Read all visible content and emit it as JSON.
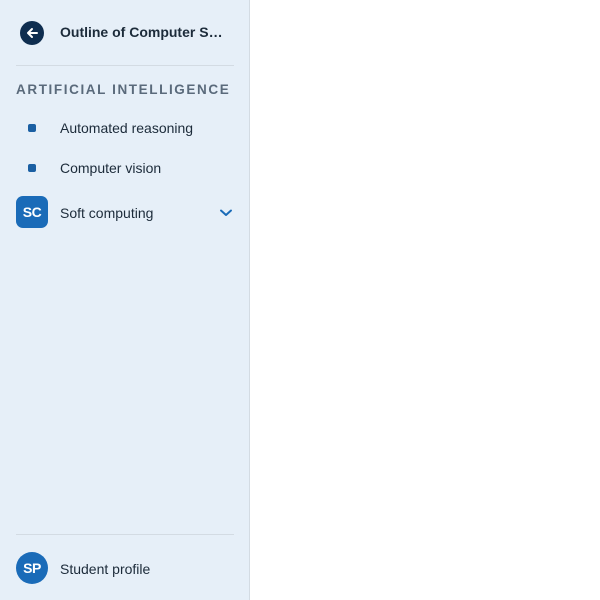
{
  "header": {
    "title": "Outline of Computer Sci...",
    "back_icon": "arrow-left-icon"
  },
  "section": {
    "heading": "ARTIFICIAL INTELLIGENCE"
  },
  "nav": {
    "items": [
      {
        "label": "Automated reasoning",
        "icon": "bullet-icon"
      },
      {
        "label": "Computer vision",
        "icon": "bullet-icon"
      },
      {
        "label": "Soft computing",
        "badge": "SC",
        "icon": "chevron-down-icon"
      }
    ]
  },
  "footer": {
    "profile_label": "Student profile",
    "profile_badge": "SP"
  },
  "colors": {
    "sidebar_bg": "#e6eff8",
    "accent": "#1a6bb8",
    "back_button": "#0e2d4f"
  }
}
